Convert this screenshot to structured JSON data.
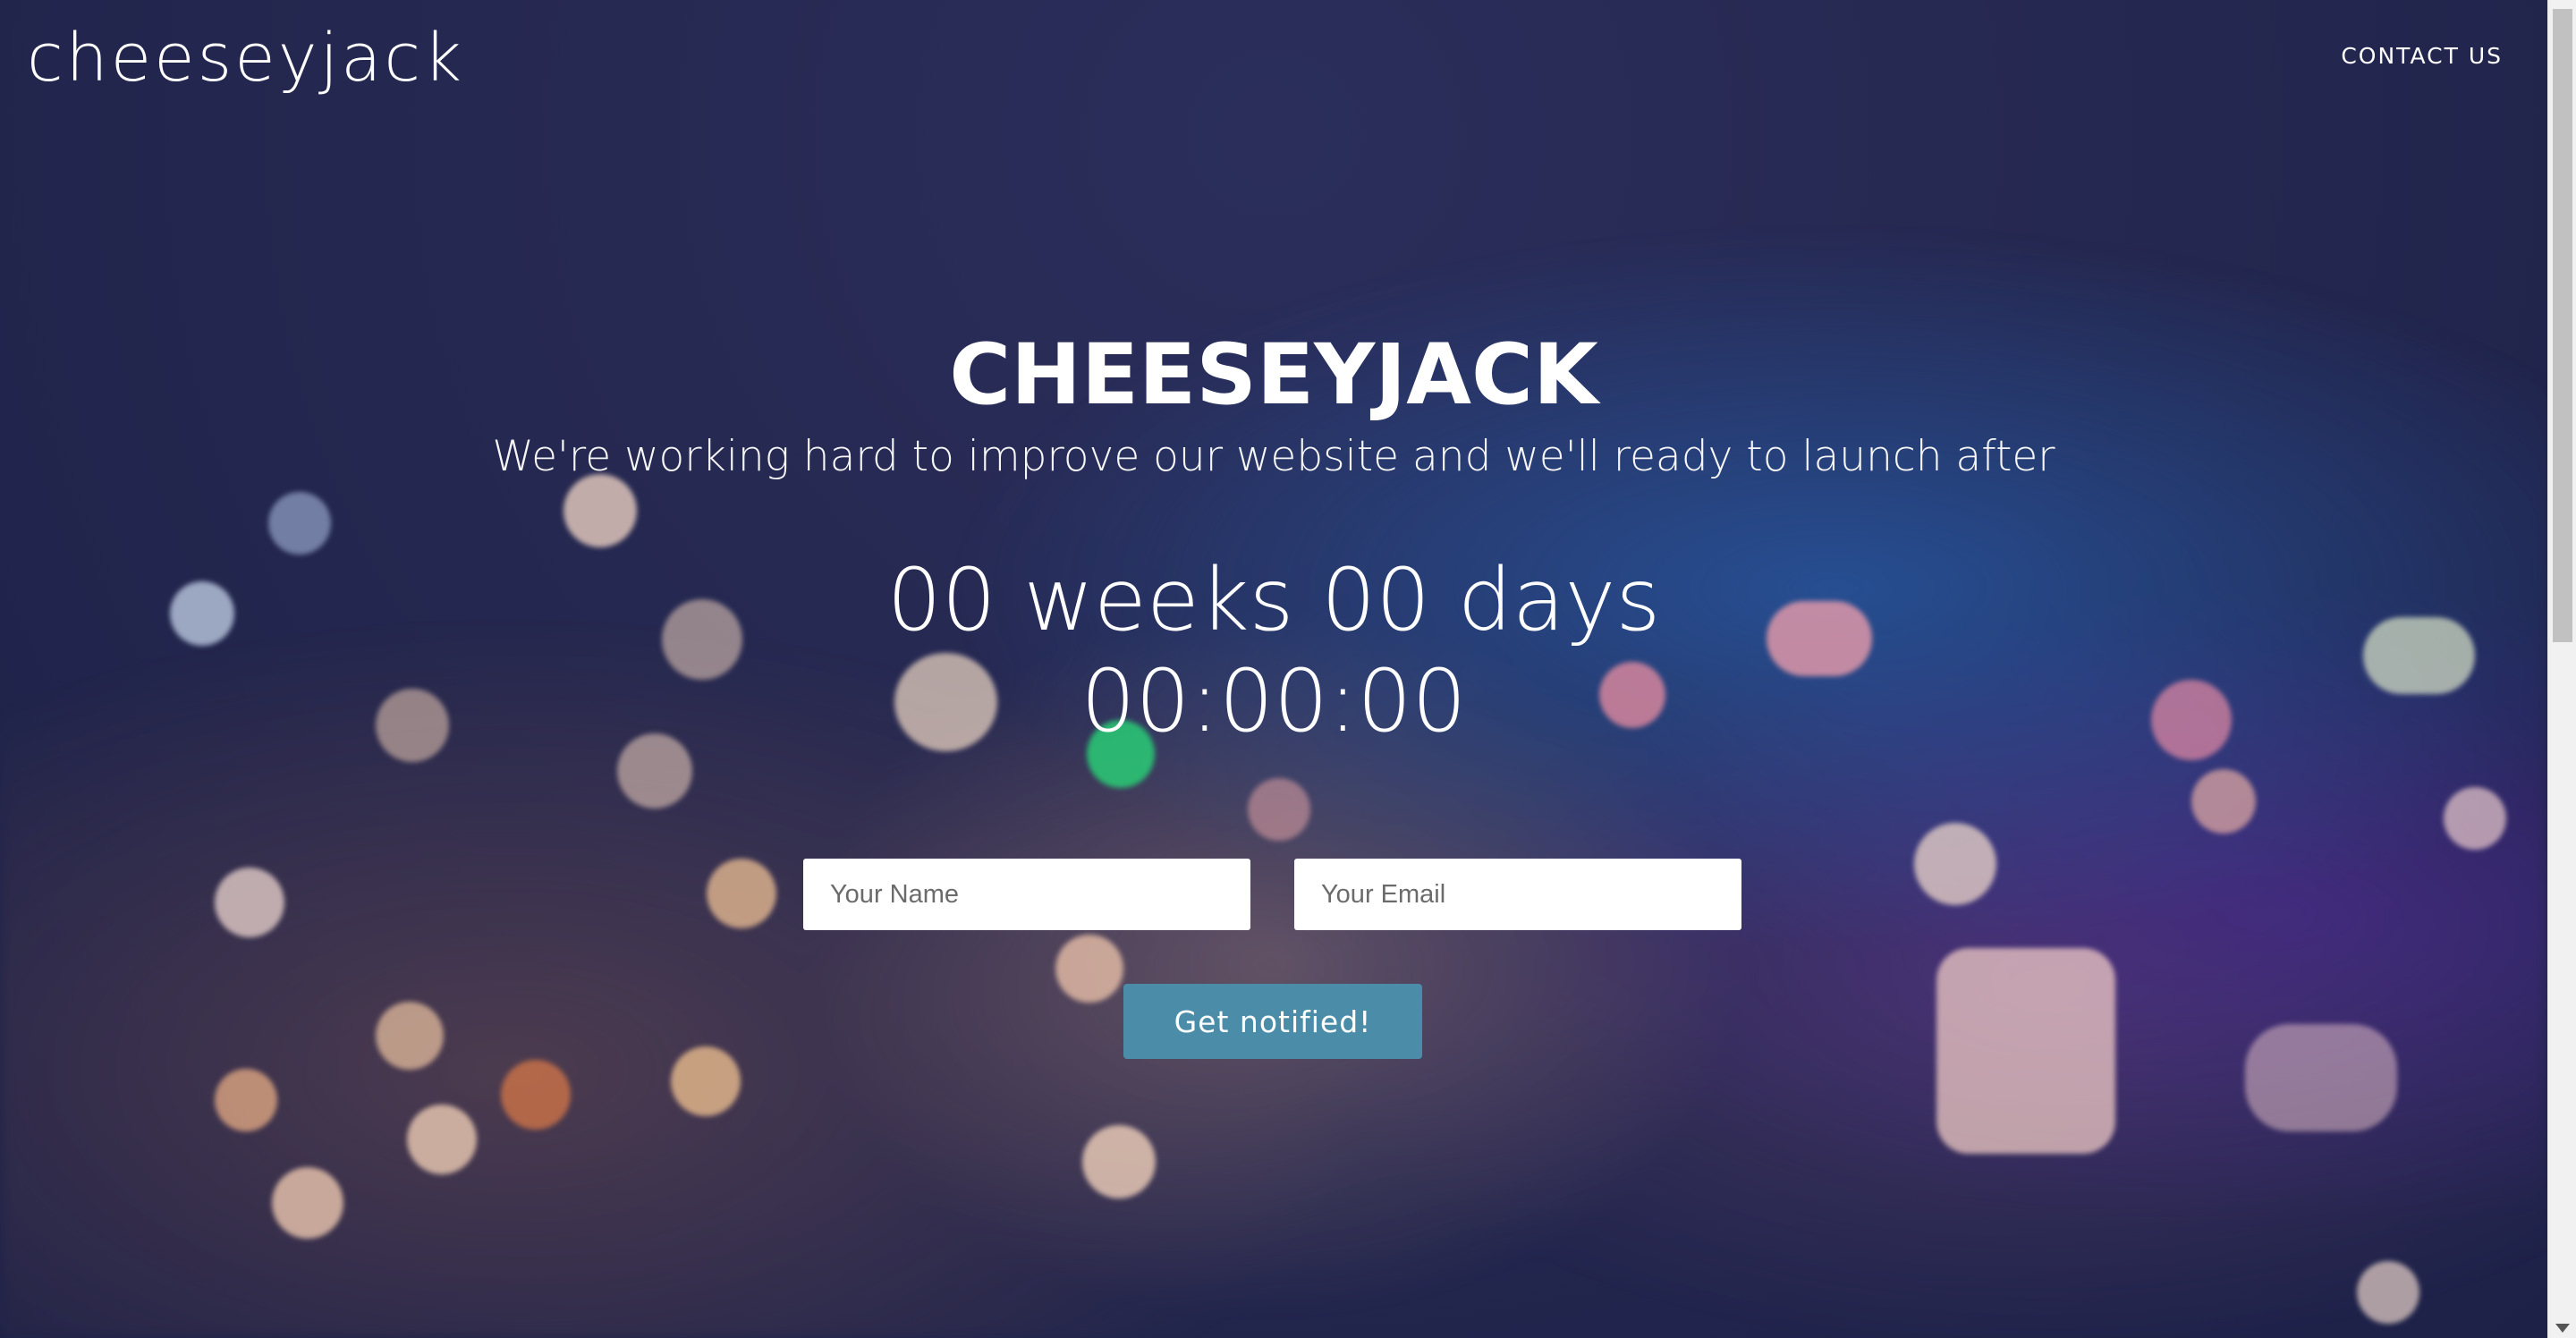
{
  "brand": {
    "name": "cheeseyjack"
  },
  "nav": {
    "contact_label": "CONTACT US"
  },
  "hero": {
    "title": "CHEESEYJACK",
    "subtitle": "We're working hard to improve our website and we'll ready to launch after",
    "countdown_line1": "00 weeks 00 days",
    "countdown_line2": "00:00:00"
  },
  "form": {
    "name_placeholder": "Your Name",
    "email_placeholder": "Your Email",
    "submit_label": "Get notified!"
  },
  "colors": {
    "background": "#26284f",
    "button": "#4b8da8",
    "input_background": "#ffffff",
    "text": "#ffffff"
  }
}
